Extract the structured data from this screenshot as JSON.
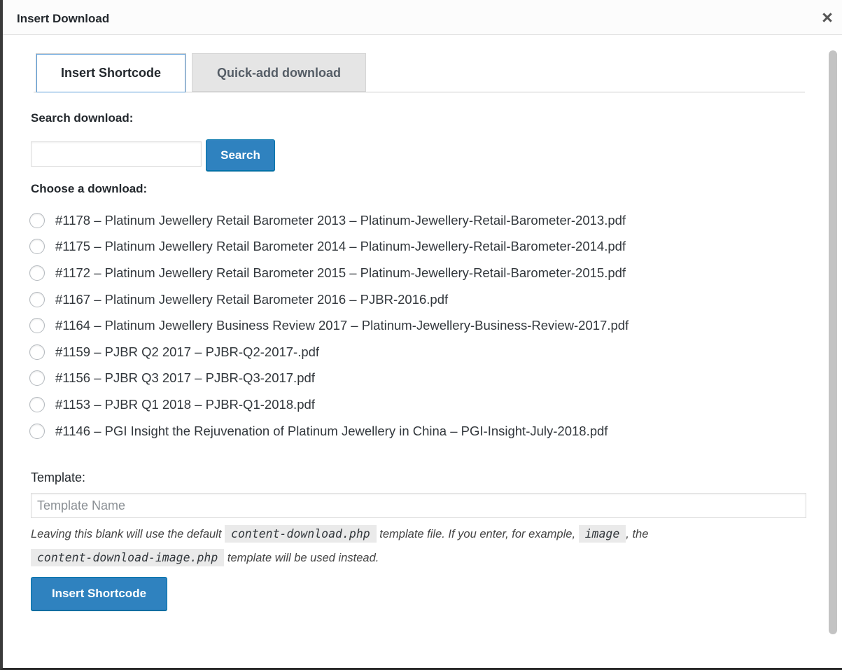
{
  "dialog": {
    "title": "Insert Download",
    "close_label": "×"
  },
  "tabs": [
    {
      "label": "Insert Shortcode",
      "active": true
    },
    {
      "label": "Quick-add download",
      "active": false
    }
  ],
  "search": {
    "label": "Search download:",
    "value": "",
    "button_label": "Search"
  },
  "choose": {
    "label": "Choose a download:",
    "items": [
      {
        "label": "#1178 – Platinum Jewellery Retail Barometer 2013 – Platinum-Jewellery-Retail-Barometer-2013.pdf",
        "selected": false
      },
      {
        "label": "#1175 – Platinum Jewellery Retail Barometer 2014 – Platinum-Jewellery-Retail-Barometer-2014.pdf",
        "selected": false
      },
      {
        "label": "#1172 – Platinum Jewellery Retail Barometer 2015 – Platinum-Jewellery-Retail-Barometer-2015.pdf",
        "selected": false
      },
      {
        "label": "#1167 – Platinum Jewellery Retail Barometer 2016 – PJBR-2016.pdf",
        "selected": false
      },
      {
        "label": "#1164 – Platinum Jewellery Business Review 2017 – Platinum-Jewellery-Business-Review-2017.pdf",
        "selected": false
      },
      {
        "label": "#1159 – PJBR Q2 2017 – PJBR-Q2-2017-.pdf",
        "selected": false
      },
      {
        "label": "#1156 – PJBR Q3 2017 – PJBR-Q3-2017.pdf",
        "selected": false
      },
      {
        "label": "#1153 – PJBR Q1 2018 – PJBR-Q1-2018.pdf",
        "selected": false
      },
      {
        "label": "#1146 – PGI Insight the Rejuvenation of Platinum Jewellery in China – PGI-Insight-July-2018.pdf",
        "selected": false
      }
    ]
  },
  "template": {
    "label": "Template:",
    "placeholder": "Template Name",
    "value": "",
    "help": {
      "part1": "Leaving this blank will use the default",
      "code1": "content-download.php",
      "part2": "template file. If you enter, for example,",
      "code2": "image",
      "part3": ", the",
      "code3": "content-download-image.php",
      "part4": "template will be used instead."
    }
  },
  "insert_button_label": "Insert Shortcode",
  "colors": {
    "primary_button": "#2f82bf",
    "active_tab_focus": "#5b9dd9"
  }
}
